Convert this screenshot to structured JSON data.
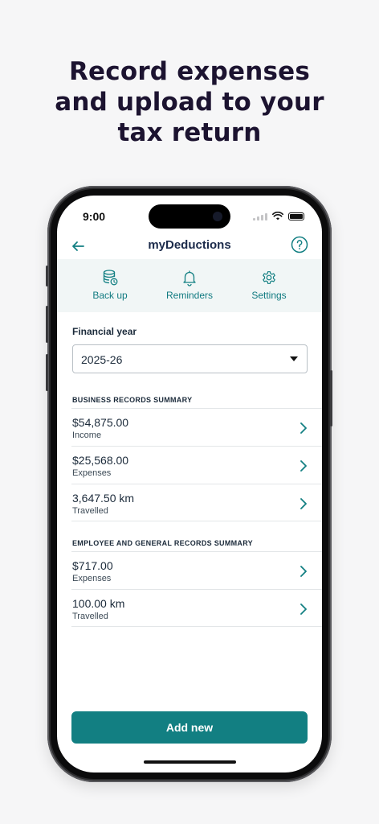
{
  "headline": [
    "Record expenses",
    "and upload to your",
    "tax return"
  ],
  "status": {
    "time": "9:00"
  },
  "nav": {
    "title": "myDeductions",
    "back_icon": "arrow-left-icon",
    "help_icon": "help-circle-icon"
  },
  "toolbar": {
    "items": [
      {
        "label": "Back up",
        "icon": "database-backup-icon"
      },
      {
        "label": "Reminders",
        "icon": "bell-icon"
      },
      {
        "label": "Settings",
        "icon": "gear-icon"
      }
    ]
  },
  "financial_year": {
    "label": "Financial year",
    "value": "2025-26"
  },
  "business": {
    "heading": "BUSINESS RECORDS SUMMARY",
    "rows": [
      {
        "value": "$54,875.00",
        "label": "Income"
      },
      {
        "value": "$25,568.00",
        "label": "Expenses"
      },
      {
        "value": "3,647.50 km",
        "label": "Travelled"
      }
    ]
  },
  "employee": {
    "heading": "EMPLOYEE AND GENERAL RECORDS SUMMARY",
    "rows": [
      {
        "value": "$717.00",
        "label": "Expenses"
      },
      {
        "value": "100.00 km",
        "label": "Travelled"
      }
    ]
  },
  "actions": {
    "add_new": "Add new"
  },
  "colors": {
    "accent": "#127f82",
    "toolbar_bg": "#f1f6f6",
    "headline": "#1c1330"
  }
}
